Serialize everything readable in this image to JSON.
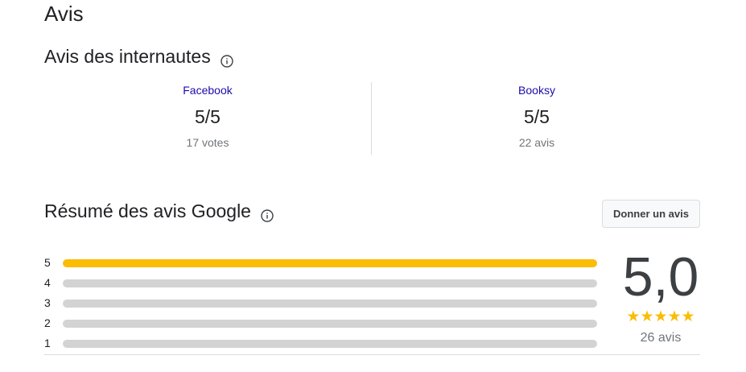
{
  "page_title": "Avis",
  "web_reviews": {
    "title": "Avis des internautes",
    "info_icon": "info-icon",
    "sources": [
      {
        "name": "Facebook",
        "score": "5/5",
        "count": "17 votes"
      },
      {
        "name": "Booksy",
        "score": "5/5",
        "count": "22 avis"
      }
    ]
  },
  "google_summary": {
    "title": "Résumé des avis Google",
    "info_icon": "info-icon",
    "write_review_button": "Donner un avis",
    "average": "5,0",
    "stars": "★★★★★",
    "total": "26 avis",
    "histogram": [
      {
        "label": "5",
        "fraction": 1.0
      },
      {
        "label": "4",
        "fraction": 0.0
      },
      {
        "label": "3",
        "fraction": 0.0
      },
      {
        "label": "2",
        "fraction": 0.0
      },
      {
        "label": "1",
        "fraction": 0.0
      }
    ]
  },
  "colors": {
    "link": "#1a0dab",
    "star": "#fbbc04",
    "bar_track": "#d3d3d3",
    "bar_fill": "#fbbc04"
  }
}
